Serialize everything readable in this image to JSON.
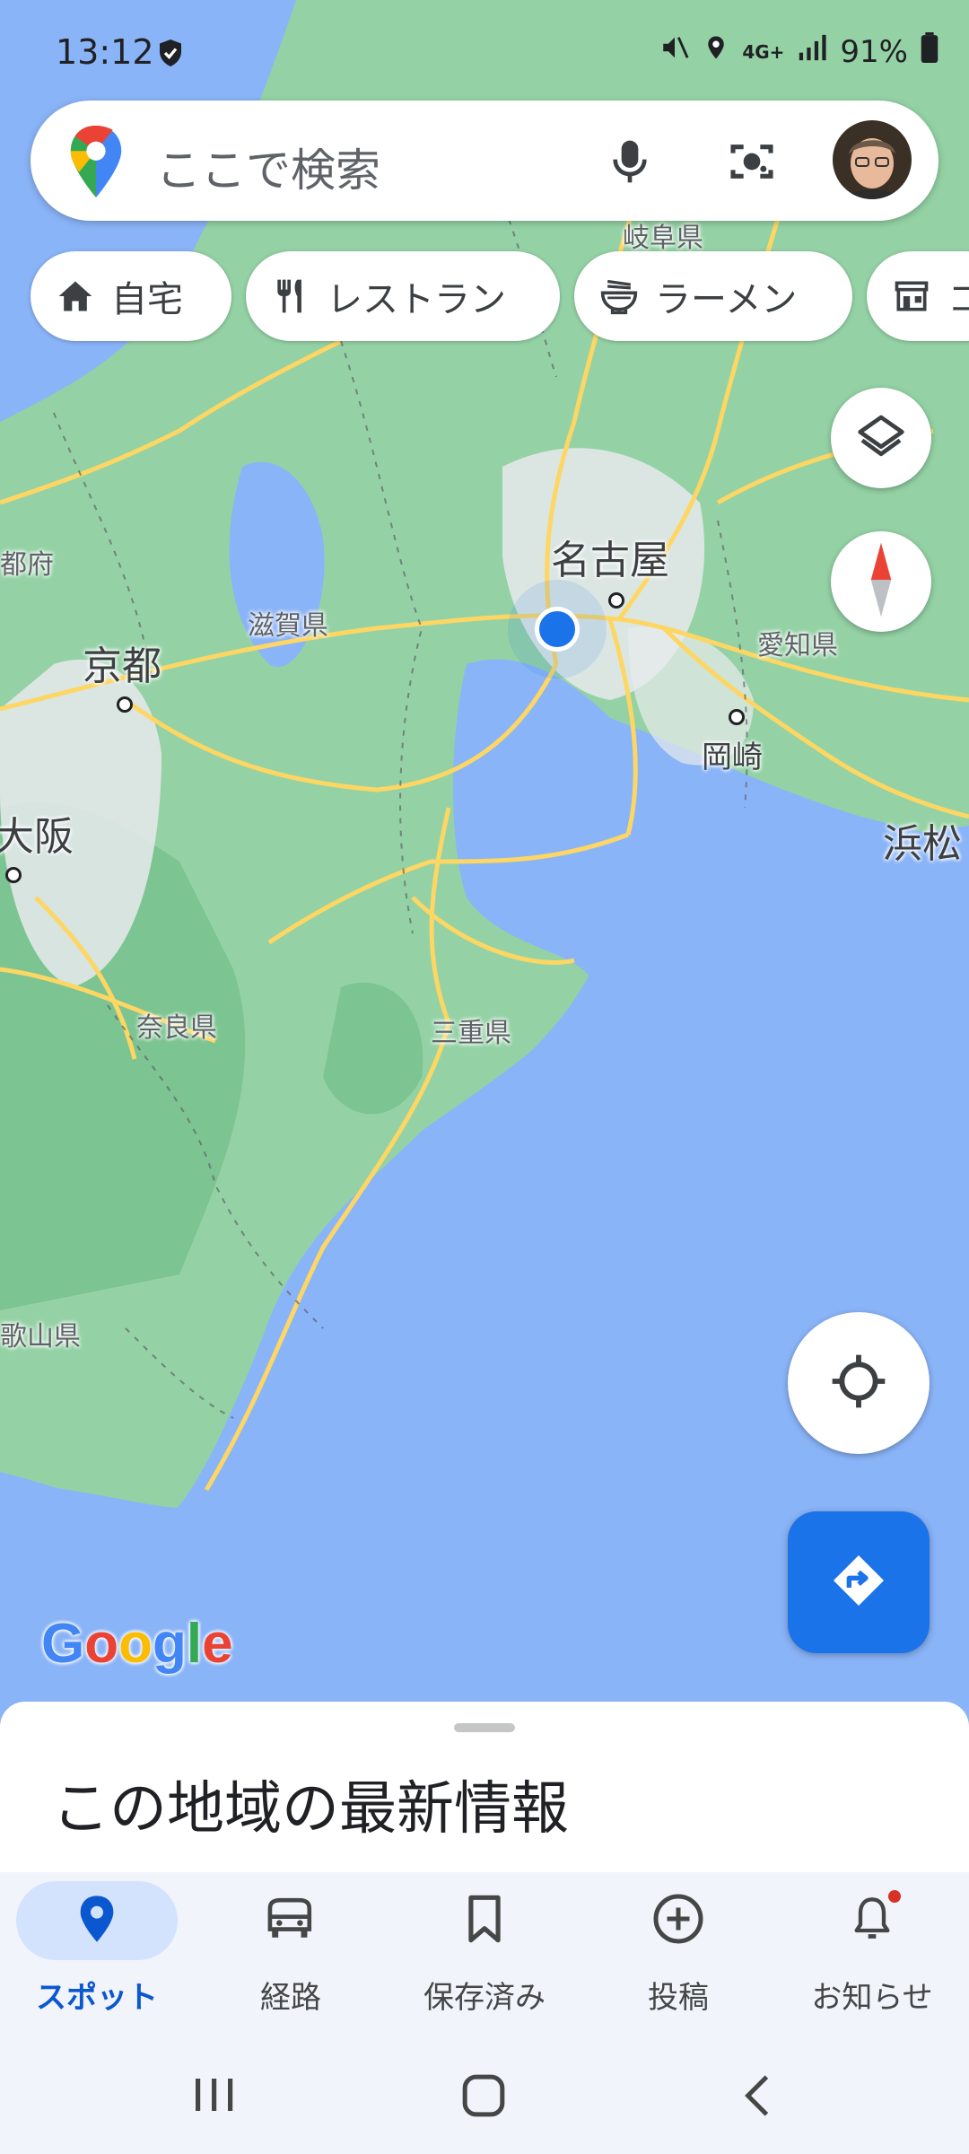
{
  "status": {
    "time": "13:12",
    "battery": "91%",
    "network": "4G+"
  },
  "search": {
    "placeholder": "ここで検索"
  },
  "chips": [
    {
      "label": "自宅",
      "icon": "home-icon"
    },
    {
      "label": "レストラン",
      "icon": "fork-knife-icon"
    },
    {
      "label": "ラーメン",
      "icon": "ramen-bowl-icon"
    },
    {
      "label": "コ",
      "icon": "convenience-store-icon"
    }
  ],
  "map": {
    "labels": {
      "gifu": "岐阜県",
      "kyotofu": "都府",
      "shiga": "滋賀県",
      "nagoya": "名古屋",
      "aichi": "愛知県",
      "kyoto": "京都",
      "okazaki": "岡崎",
      "osaka": "大阪",
      "hamamatsu": "浜松",
      "nara": "奈良県",
      "mie": "三重県",
      "wakayama": "歌山県"
    },
    "logo": "Google"
  },
  "sheet": {
    "title": "この地域の最新情報"
  },
  "nav": [
    {
      "label": "スポット",
      "icon": "location-pin-icon",
      "active": true
    },
    {
      "label": "経路",
      "icon": "car-icon",
      "active": false
    },
    {
      "label": "保存済み",
      "icon": "bookmark-icon",
      "active": false
    },
    {
      "label": "投稿",
      "icon": "add-circle-icon",
      "active": false
    },
    {
      "label": "お知らせ",
      "icon": "bell-icon",
      "active": false
    }
  ],
  "colors": {
    "accent": "#1a73e8",
    "water": "#8ab4f8",
    "land": "#94d2a5",
    "road": "#fdd663"
  }
}
